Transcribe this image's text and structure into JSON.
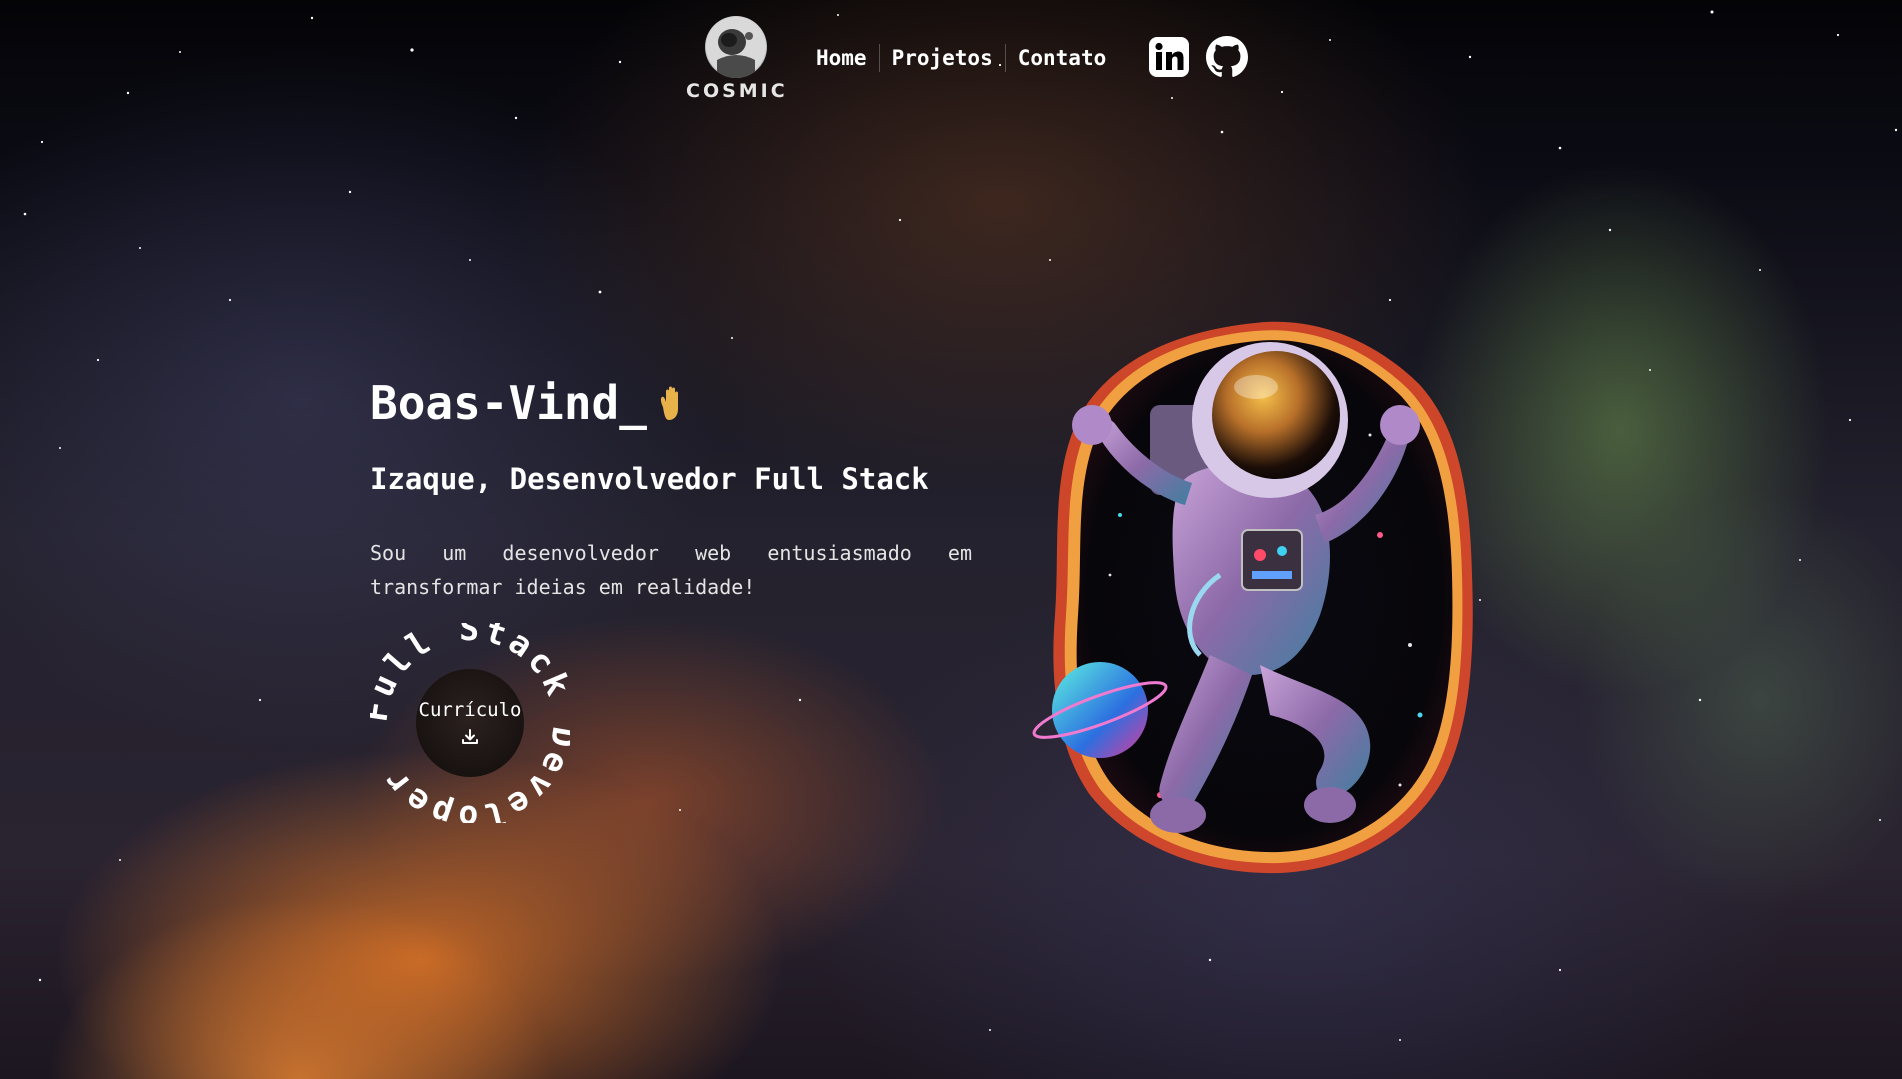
{
  "header": {
    "logo_text": "COSMIC",
    "nav": [
      {
        "label": "Home"
      },
      {
        "label": "Projetos"
      },
      {
        "label": "Contato"
      }
    ],
    "social": [
      {
        "icon": "linkedin-icon"
      },
      {
        "icon": "github-icon"
      }
    ]
  },
  "hero": {
    "greeting": "Boas-Vind_",
    "greeting_icon": "waving-hand-icon",
    "subtitle": "Izaque, Desenvolvedor Full Stack",
    "description": "Sou um desenvolvedor web entusiasmado em transformar ideias em realidade!",
    "cv_ring_text": "Full Stack Developer",
    "cv_button_label": "Currículo",
    "cv_button_icon": "download-icon"
  },
  "colors": {
    "accent_hand": "#e8b24a",
    "text": "#ffffff"
  }
}
